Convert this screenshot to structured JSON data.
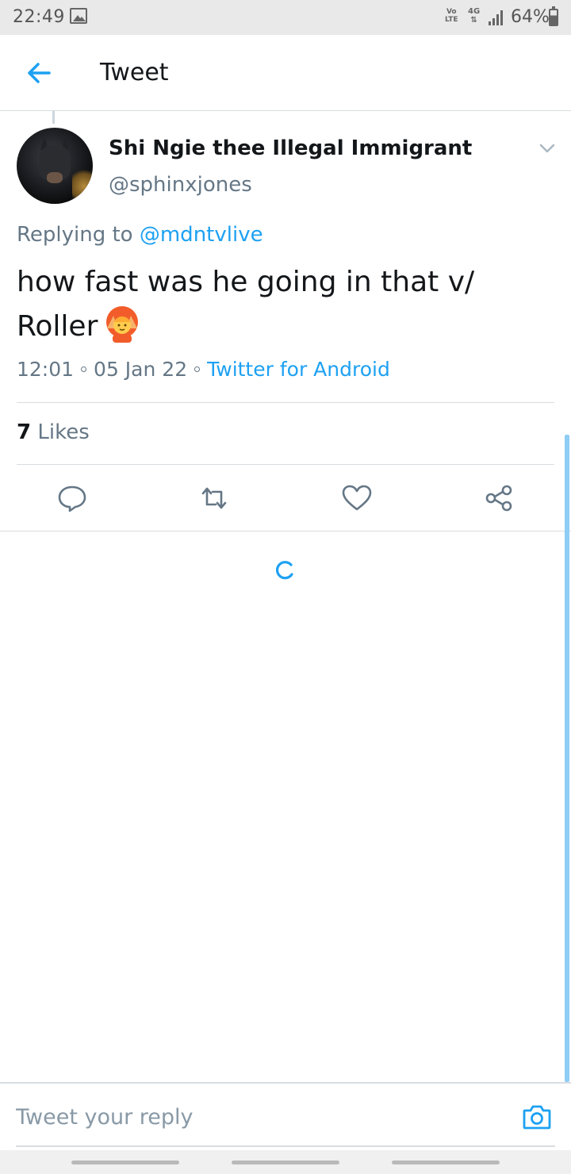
{
  "status_bar": {
    "time": "22:49",
    "volte_top": "Vo",
    "volte_bottom": "LTE",
    "network": "4G",
    "network_arrows": "⇅",
    "battery": "64%"
  },
  "header": {
    "title": "Tweet"
  },
  "tweet": {
    "author_name": "Shi Ngie thee Illegal Immigrant",
    "author_handle": "@sphinxjones",
    "replying_prefix": "Replying to",
    "replying_to": "@mdntvlive",
    "text": "how fast was he going in that v/ Roller",
    "time": "12:01",
    "date": "05 Jan 22",
    "source": "Twitter for Android",
    "likes_count": "7",
    "likes_label": "Likes"
  },
  "reply": {
    "placeholder": "Tweet your reply"
  },
  "colors": {
    "accent": "#1da1f2",
    "secondary_text": "#657786",
    "divider": "#d8dde1"
  },
  "icons": [
    "back-arrow-icon",
    "caret-down-icon",
    "reply-icon",
    "retweet-icon",
    "like-icon",
    "share-icon",
    "loading-spinner-icon",
    "camera-icon",
    "gallery-icon",
    "signal-icon",
    "battery-icon"
  ]
}
